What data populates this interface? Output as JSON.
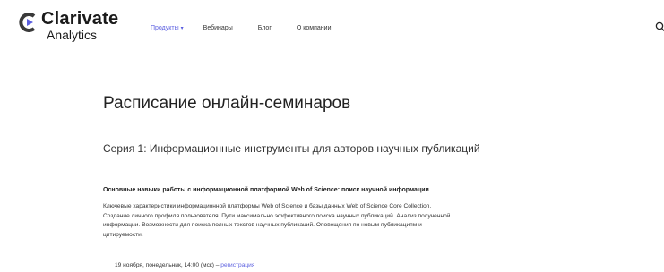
{
  "brand": {
    "name": "Clarivate",
    "subname": "Analytics",
    "colors": {
      "mark_dark": "#3a3a3a",
      "mark_accent": "#5b5fe0"
    }
  },
  "nav": {
    "items": [
      {
        "label": "Продукты",
        "active": true,
        "has_dropdown": true
      },
      {
        "label": "Вебинары",
        "active": false
      },
      {
        "label": "Блог",
        "active": false
      },
      {
        "label": "О компании",
        "active": false
      }
    ],
    "search_icon": "search-icon"
  },
  "main": {
    "page_title": "Расписание онлайн-семинаров",
    "series_title": "Серия 1: Информационные инструменты для авторов научных публикаций",
    "section_heading": "Основные навыки работы с информационной платформой Web of Science: поиск научной информации",
    "description_lines": [
      "Ключевые характеристики информационной платформы Web of Science и базы данных Web of Science Core Collection.",
      "Создание личного профиля пользователя. Пути максимально эффективного поиска научных публикаций. Анализ полученной",
      "информации. Возможности для поиска полных текстов научных публикаций. Оповещения по новым публикациям и",
      "цитируемости."
    ],
    "event": {
      "date": "19 ноября, понедельник, 14:00 (мск)",
      "separator": " – ",
      "link_label": "регистрация"
    }
  },
  "colors": {
    "accent": "#5b5fe0",
    "text": "#222222",
    "background": "#ffffff"
  }
}
